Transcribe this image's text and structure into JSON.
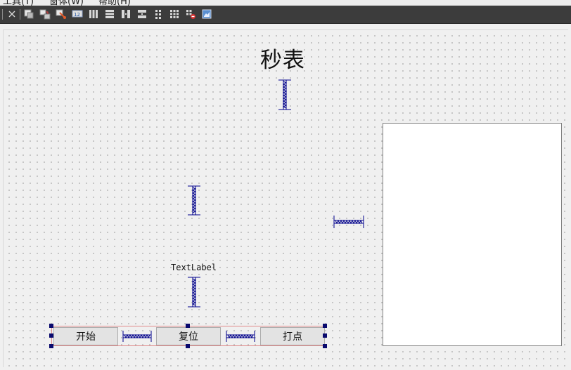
{
  "menu": {
    "items": [
      "工具(T)",
      "窗体(W)",
      "帮助(H)"
    ]
  },
  "toolbar": {
    "buttons": [
      {
        "icon": "close-icon"
      },
      {
        "icon": "edit-widgets-icon"
      },
      {
        "icon": "edit-signals-slots-icon"
      },
      {
        "icon": "edit-buddies-icon"
      },
      {
        "icon": "edit-tab-order-icon"
      },
      {
        "icon": "lay-out-horizontally-icon"
      },
      {
        "icon": "lay-out-vertically-icon"
      },
      {
        "icon": "lay-out-horizontal-splitter-icon"
      },
      {
        "icon": "lay-out-vertical-splitter-icon"
      },
      {
        "icon": "lay-out-form-icon"
      },
      {
        "icon": "lay-out-grid-icon"
      },
      {
        "icon": "break-layout-icon"
      },
      {
        "icon": "adjust-size-icon"
      }
    ]
  },
  "form": {
    "title_label": "秒表",
    "text_label": "TextLabel",
    "buttons": {
      "start": "开始",
      "reset": "复位",
      "mark": "打点"
    }
  },
  "colors": {
    "toolbar_bg": "#3c3c3c",
    "spacer": "#00008b",
    "layout_border": "#e08a8a",
    "handle": "#0a0a6e"
  }
}
